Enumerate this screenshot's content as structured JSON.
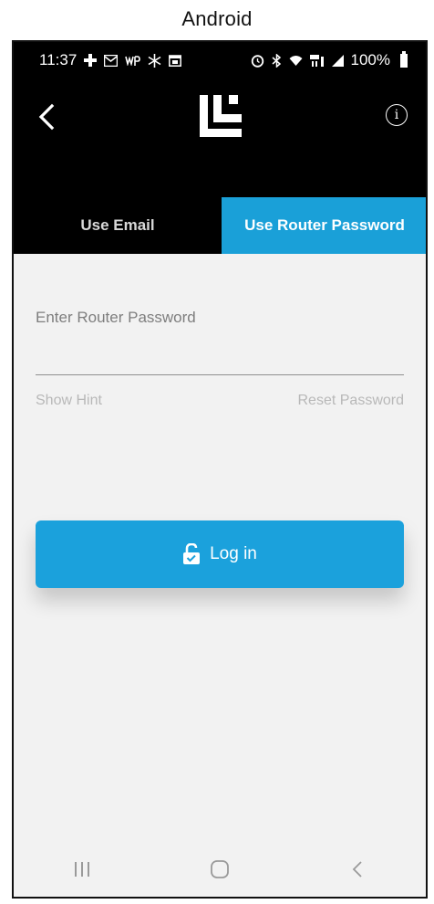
{
  "caption": "Android",
  "status_bar": {
    "time": "11:37",
    "battery": "100%",
    "left_icons": [
      "dialpad-icon",
      "mail-icon",
      "wp-icon",
      "snowflake-icon",
      "calendar-icon"
    ],
    "right_icons": [
      "alarm-icon",
      "bluetooth-icon",
      "wifi-icon",
      "lte-icon",
      "signal-icon",
      "battery-icon"
    ]
  },
  "tabs": [
    {
      "label": "Use Email",
      "active": false
    },
    {
      "label": "Use Router Password",
      "active": true
    }
  ],
  "form": {
    "label": "Enter Router Password",
    "show_hint": "Show Hint",
    "reset_password": "Reset Password"
  },
  "login_button": {
    "label": "Log in"
  },
  "colors": {
    "accent": "#1aa0d8",
    "header": "#000000",
    "background": "#f2f2f2"
  },
  "nav_bar": [
    "recent-apps-icon",
    "home-icon",
    "back-nav-icon"
  ]
}
